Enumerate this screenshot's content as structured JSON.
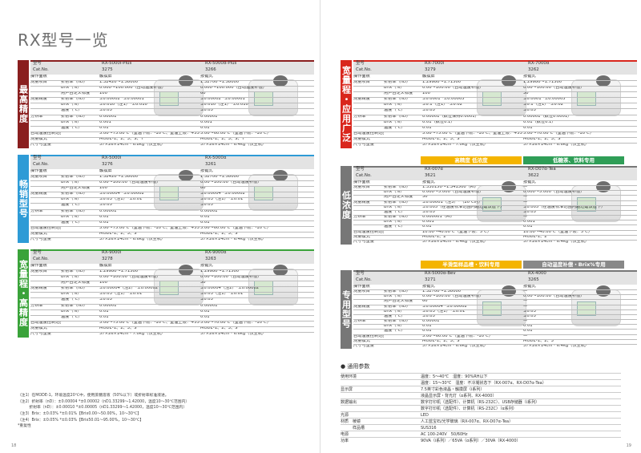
{
  "page_title": "RX型号一览",
  "left_sections": [
    {
      "label": "最高精度",
      "color": "#8a1f1f",
      "models": [
        "RX-5000i-Plus",
        "RX-5000α-Plus"
      ],
      "catnos": [
        "3275",
        "3266"
      ],
      "label_model": "型号",
      "label_cat": "Cat.No.",
      "rows": [
        [
          "操作面板",
          "",
          "触摸屏",
          "按键式"
        ],
        [
          "测量项目",
          "折射率（nD）",
          "1.32420～1.58000",
          "1.32700～1.58000"
        ],
        [
          "",
          "Brix（%）",
          "0.000～100.000（自动温度补偿）",
          "0.000～100.000（自动温度补偿）"
        ],
        [
          "",
          "用户自定义标度",
          "100",
          "60"
        ],
        [
          "测量精度",
          "折射率（nD）",
          "±0.00002 *±0.00001",
          "±0.00002 *±0.00001"
        ],
        [
          "",
          "Brix（%）",
          "±0.010（注1）*±0.010",
          "±0.010（注1）*±0.010"
        ],
        [
          "",
          "温度（℃）",
          "±0.05",
          "±0.05"
        ],
        [
          "分辨率",
          "折射率（nD）",
          "0.00001",
          "0.00001"
        ],
        [
          "",
          "Brix（%）",
          "0.001",
          "0.001"
        ],
        [
          "",
          "温度（℃）",
          "0.01",
          "0.01"
        ],
        [
          "自动温度控制范围",
          "",
          "5.00～75.00℃（室温下限：-10℃、室温上限：+55℃）",
          "5.00～60.00℃（室温下限：-10℃）"
        ],
        [
          "测量模式",
          "",
          "MODE-1、2、3、S、T",
          "MODE-1、2、3、S、T"
        ],
        [
          "尺寸与重量",
          "",
          "37×26×14cm・6.8kg（仅主机）",
          "37×26×14cm・6.4kg（仅主机）"
        ]
      ]
    },
    {
      "label": "畅销型号",
      "color": "#2e9bd6",
      "models": [
        "RX-5000i",
        "RX-5000α"
      ],
      "catnos": [
        "3276",
        "3261"
      ],
      "label_model": "型号",
      "label_cat": "Cat.No.",
      "rows": [
        [
          "操作面板",
          "",
          "触摸屏",
          "按键式"
        ],
        [
          "测量项目",
          "折射率（nD）",
          "1.32420～1.58000",
          "1.32700～1.58000"
        ],
        [
          "",
          "Brix（%）",
          "0.00～100.00（自动温度补偿）",
          "0.00～100.00（自动温度补偿）"
        ],
        [
          "",
          "用户自定义标度",
          "100",
          "60"
        ],
        [
          "测量精度",
          "折射率（nD）",
          "±0.00004 *±0.00002",
          "±0.00004 *±0.00002"
        ],
        [
          "",
          "Brix（%）",
          "±0.03（注1）*±0.01",
          "±0.03（注1）*±0.01"
        ],
        [
          "",
          "温度（℃）",
          "±0.05",
          "±0.05"
        ],
        [
          "分辨率",
          "折射率（nD）",
          "0.00001",
          "0.00001"
        ],
        [
          "",
          "Brix（%）",
          "0.01",
          "0.01"
        ],
        [
          "",
          "温度（℃）",
          "0.01",
          "0.01"
        ],
        [
          "自动温度控制范围",
          "",
          "5.00～75.00℃（室温下限：-10℃、室温上限：+55℃）",
          "5.00～60.00℃（室温下限：-10℃）"
        ],
        [
          "测量模式",
          "",
          "MODE-1、2、3、S",
          "MODE-1、2、3、S"
        ],
        [
          "尺寸与重量",
          "",
          "37×26×14cm・6.6kg（仅主机）",
          "37×26×14cm・6.4kg（仅主机）"
        ]
      ]
    },
    {
      "label": "宽量程・高精度",
      "color": "#3aa33a",
      "models": [
        "RX-9000i",
        "RX-9000α"
      ],
      "catnos": [
        "3278",
        "3263"
      ],
      "label_model": "型号",
      "label_cat": "Cat.No.",
      "rows": [
        [
          "操作面板",
          "",
          "触摸屏",
          "按键式"
        ],
        [
          "测量项目",
          "折射率（nD）",
          "1.29980～1.71500",
          "1.29980～1.71500"
        ],
        [
          "",
          "Brix（%）",
          "0.00～100.00（自动温度补偿）",
          "0.00～100.00（自动温度补偿）"
        ],
        [
          "",
          "用户自定义标度",
          "100",
          "30"
        ],
        [
          "测量精度",
          "折射率（nD）",
          "±0.00004（注2）*±0.00002",
          "±0.00004（注2）*±0.00002"
        ],
        [
          "",
          "Brix（%）",
          "±0.03（注1）*±0.01",
          "±0.03（注1）*±0.01"
        ],
        [
          "",
          "温度（℃）",
          "±0.05",
          "±0.05"
        ],
        [
          "分辨率",
          "折射率（nD）",
          "0.00001",
          "0.00001"
        ],
        [
          "",
          "Brix（%）",
          "0.01",
          "0.01"
        ],
        [
          "",
          "温度（℃）",
          "0.01",
          "0.01"
        ],
        [
          "自动温度控制范围",
          "",
          "5.00～75.00℃（室温下限：-10℃、室温上限：+55℃）",
          "5.00～70.00℃（室温下限：-10℃）"
        ],
        [
          "测量模式",
          "",
          "MODE-1、2、3、S",
          "MODE-1、2、3、S"
        ],
        [
          "尺寸与重量",
          "",
          "37×26×14cm・7.0kg（仅主机）",
          "37×26×14cm・6.6kg（仅主机）"
        ]
      ]
    }
  ],
  "right_sections": [
    {
      "label": "宽量程・应用广泛",
      "color": "#d9261c",
      "cat_bar": null,
      "models": [
        "RX-7000i",
        "RX-7000α"
      ],
      "catnos": [
        "3279",
        "3262"
      ],
      "rows": [
        [
          "操作面板",
          "",
          "触摸屏",
          "按键式"
        ],
        [
          "测量项目",
          "折射率（nD）",
          "1.29980～1.71500",
          "1.29980～1.71500"
        ],
        [
          "",
          "Brix（%）",
          "0.00～100.00（自动温度补偿）",
          "0.00～100.00（自动温度补偿）"
        ],
        [
          "",
          "用户自定义标度",
          "100",
          "30"
        ],
        [
          "测量精度",
          "折射率（nD）",
          "±0.0001 *±0.00005",
          "±0.0001 *±0.00005"
        ],
        [
          "",
          "Brix（%）",
          "±0.1（注1）*±0.02",
          "±0.1（注1）*±0.02"
        ],
        [
          "",
          "温度（℃）",
          "±0.05",
          "±0.05"
        ],
        [
          "分辨率",
          "折射率（nD）",
          "0.00001（数位保持0.0001）",
          "0.00001（数位0.0001）"
        ],
        [
          "",
          "Brix（%）",
          "0.01（数位0.1）",
          "0.01（数位0.1）"
        ],
        [
          "",
          "温度（℃）",
          "0.01",
          "0.01"
        ],
        [
          "自动温度控制范围",
          "",
          "5.00～75.00℃（室温下限：-10℃、室温上限：+55℃）",
          "5.00～70.00℃（室温下限：-10℃）"
        ],
        [
          "测量模式",
          "",
          "MODE-1、2、3、S",
          "MODE-1、2、3、S"
        ],
        [
          "尺寸与重量",
          "",
          "37×26×14cm・7.0kg（仅主机）",
          "37×26×14cm・6.6kg（仅主机）"
        ]
      ]
    },
    {
      "label": "低浓度",
      "color": "#777777",
      "cat_bar": [
        "高精度 低浓度",
        "低糖茶、饮料专用"
      ],
      "cat_colors": [
        "#f4b400",
        "#2f9e57"
      ],
      "models": [
        "RX-007α",
        "RX-D07α-Tea"
      ],
      "catnos": [
        "3621",
        "3622"
      ],
      "rows": [
        [
          "操作面板",
          "",
          "按键式",
          "按键式"
        ],
        [
          "测量项目",
          "折射率（nD）",
          "1.330150～1.341500（RI）",
          "—"
        ],
        [
          "",
          "Brix（%）",
          "0.000～5.000（自动温度补偿）",
          "0.000～5.000（自动温度补偿）"
        ],
        [
          "",
          "用户自定义标度",
          "30",
          "—"
        ],
        [
          "测量精度",
          "折射率（nD）",
          "±0.00001（注3）*（20℃时）",
          "—"
        ],
        [
          "",
          "Brix（%）",
          "±0.005（在温度校准范围内超过建议值下）",
          "±0.005（在温度校准范围内超过建议值下）"
        ],
        [
          "",
          "温度（℃）",
          "±0.05",
          "±0.05"
        ],
        [
          "分辨率",
          "折射率（nD）",
          "0.000001（RI）",
          "—"
        ],
        [
          "",
          "Brix（%）",
          "0.001",
          "0.001"
        ],
        [
          "",
          "温度（℃）",
          "0.01",
          "0.01"
        ],
        [
          "自动温度控制范围",
          "",
          "10.00～40.00℃（室温下限：5℃）",
          "10.00～40.00℃（室温下限：5℃）"
        ],
        [
          "测量模式",
          "",
          "MODE-1、2",
          "MODE-1、2"
        ],
        [
          "尺寸与重量",
          "",
          "37×26×14cm・6.4kg（仅主机）",
          "37×26×14cm・6.4kg（仅主机）"
        ]
      ]
    },
    {
      "label": "专用型号",
      "color": "#777777",
      "cat_bar": [
        "半滑型样品槽・饮料专用",
        "自动温度补偿・Brix%专用"
      ],
      "cat_colors": [
        "#f4b400",
        "#888888"
      ],
      "models": [
        "RX-5000α-Bev",
        "RX-4000"
      ],
      "catnos": [
        "3271",
        "3265"
      ],
      "rows": [
        [
          "操作面板",
          "",
          "按键式",
          "按键式"
        ],
        [
          "测量项目",
          "折射率（nD）",
          "1.32700～1.58000",
          "—"
        ],
        [
          "",
          "Brix（%）",
          "0.00～100.00（自动温度补偿）",
          "0.00～100.00（自动温度补偿）"
        ],
        [
          "",
          "用户自定义标度",
          "60",
          "—"
        ],
        [
          "测量精度",
          "折射率（nD）",
          "±0.00004 *±0.00002",
          "—"
        ],
        [
          "",
          "Brix（%）",
          "±0.03（注1）*±0.01",
          "±0.03"
        ],
        [
          "",
          "温度（℃）",
          "±0.05",
          "±0.05"
        ],
        [
          "分辨率",
          "折射率（nD）",
          "0.00001",
          "—"
        ],
        [
          "",
          "Brix（%）",
          "0.01",
          "0.01"
        ],
        [
          "",
          "温度（℃）",
          "0.01",
          "0.01"
        ],
        [
          "自动温度控制范围",
          "",
          "5.00～60.00℃（室温下限：-10℃）",
          "—"
        ],
        [
          "测量模式",
          "",
          "MODE-1、2、3、S",
          "MODE-1、2、3"
        ],
        [
          "尺寸与重量",
          "",
          "37×26×14cm・6.6kg（仅主机）",
          "37×26×14cm・6.4kg（仅主机）"
        ]
      ]
    }
  ],
  "general_params": {
    "heading": "通用参数",
    "rows": [
      [
        "使用环境",
        "温度：5～40℃　湿度：90%RH以下"
      ],
      [
        "",
        "温度：15～30℃　湿度：不冷凝状态下（RX-007α、RX-D07α-Tea）"
      ],
      [
        "显示屏",
        "7.5英寸彩色液晶・触摸屏（i系列）"
      ],
      [
        "",
        "液晶显示屏・背光灯（α系列、RX-4000）"
      ],
      [
        "数据输出",
        "数字打印机（选配件）、计算机（RS-232C）、USB存储器（i系列）"
      ],
      [
        "",
        "数字打印机（选配件）、计算机（RS-232C）（α系列）"
      ],
      [
        "光源",
        "LED"
      ],
      [
        "材质　棱镜",
        "人工蓝宝石/光学玻璃（RX-007α、RX-D07α-Tea）"
      ],
      [
        "　　　样品槽",
        "SUS316"
      ],
      [
        "电源",
        "AC 100-240V　50/60Hz"
      ],
      [
        "功率",
        "90VA（i系列）／65VA（α系列）／30VA（RX-4000）"
      ]
    ]
  },
  "notes": [
    "（注1）在MODE-1，环境温度20℃中，使用蔗糖溶液（50%以下）或折射率标准液进。",
    "（注2）折射率（nD）：±0.00004 *±0.00002（nD1.33299～1.42000，温度10～30℃范围内）",
    "　　　折射率（nD）：±0.00010 *±0.00005（nD1.33299～1.42000，温度10～30℃范围内）",
    "（注3）Brix：±0.03% *±0.01%【Brix0.00～50.00%，10～30℃】",
    "（注4）Brix：±0.05% *±0.03%【Brix50.01～95.00%，10～30℃】",
    "*重复性"
  ],
  "page_numbers": [
    "18",
    "19"
  ]
}
